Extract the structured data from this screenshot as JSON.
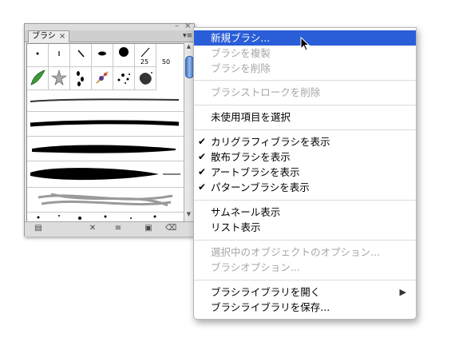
{
  "panel": {
    "tab_label": "ブラシ",
    "tab_close": "×",
    "minimize": "–",
    "close": "×",
    "menu_icon": "▾≡",
    "size_labels": {
      "s25": "25",
      "s50": "50"
    },
    "scroll_up": "▲",
    "scroll_down": "▼",
    "footer_icons": [
      "brush-libraries-icon",
      "remove-stroke-icon",
      "options-icon",
      "new-brush-icon",
      "trash-icon"
    ]
  },
  "menu": {
    "items": [
      {
        "label": "新規ブラシ...",
        "state": "highlighted"
      },
      {
        "label": "ブラシを複製",
        "state": "disabled"
      },
      {
        "label": "ブラシを削除",
        "state": "disabled"
      },
      {
        "label": "ブラシストロークを削除",
        "state": "disabled"
      },
      {
        "label": "未使用項目を選択",
        "state": "enabled"
      },
      {
        "label": "カリグラフィブラシを表示",
        "state": "checked"
      },
      {
        "label": "散布ブラシを表示",
        "state": "checked"
      },
      {
        "label": "アートブラシを表示",
        "state": "checked"
      },
      {
        "label": "パターンブラシを表示",
        "state": "checked"
      },
      {
        "label": "サムネール表示",
        "state": "enabled"
      },
      {
        "label": "リスト表示",
        "state": "enabled"
      },
      {
        "label": "選択中のオブジェクトのオプション...",
        "state": "disabled"
      },
      {
        "label": "ブラシオプション...",
        "state": "disabled"
      },
      {
        "label": "ブラシライブラリを開く",
        "state": "submenu"
      },
      {
        "label": "ブラシライブラリを保存...",
        "state": "enabled"
      }
    ],
    "check_mark": "✔",
    "submenu_arrow": "▶"
  },
  "colors": {
    "highlight": "#2a5ed8",
    "disabled_text": "#a6a6a6"
  }
}
